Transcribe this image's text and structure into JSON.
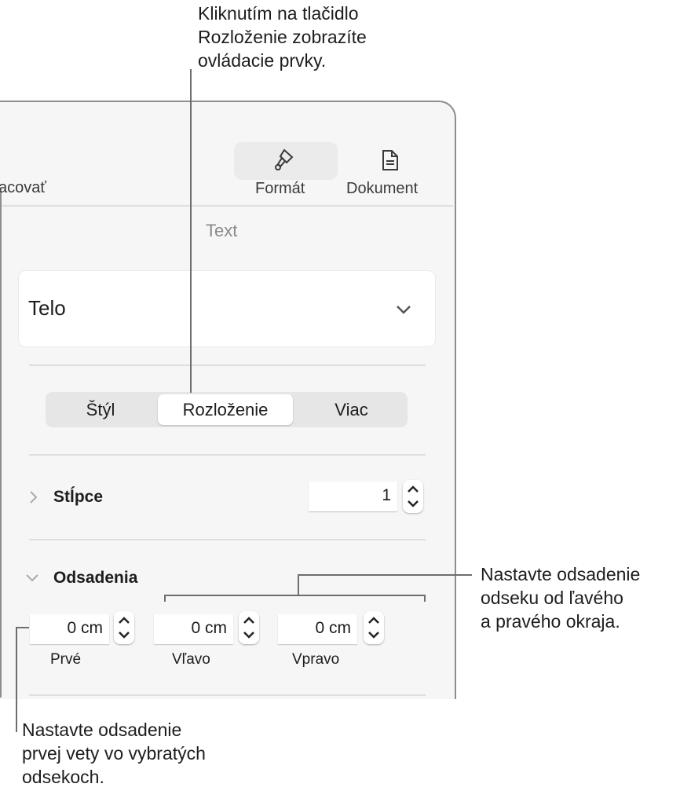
{
  "callouts": {
    "layout": [
      "Kliknutím na tlačidlo",
      "Rozloženie zobrazíte",
      "ovládacie prvky."
    ],
    "indents": [
      "Nastavte odsadenie",
      "odseku od ľavého",
      "a pravého okraja."
    ],
    "first": [
      "Nastavte odsadenie",
      "prvej vety vo vybratých",
      "odsekoch."
    ]
  },
  "toolbar": {
    "left_partial": "acovať",
    "format": "Formát",
    "document": "Dokument"
  },
  "section_title": "Text",
  "style_popup": {
    "value": "Telo"
  },
  "tabs": [
    {
      "label": "Štýl"
    },
    {
      "label": "Rozloženie",
      "selected": true
    },
    {
      "label": "Viac"
    }
  ],
  "columns": {
    "label": "Stĺpce",
    "value": "1"
  },
  "indents": {
    "label": "Odsadenia",
    "fields": [
      {
        "value": "0 cm",
        "label": "Prvé"
      },
      {
        "value": "0 cm",
        "label": "Vľavo"
      },
      {
        "value": "0 cm",
        "label": "Vpravo"
      }
    ]
  }
}
